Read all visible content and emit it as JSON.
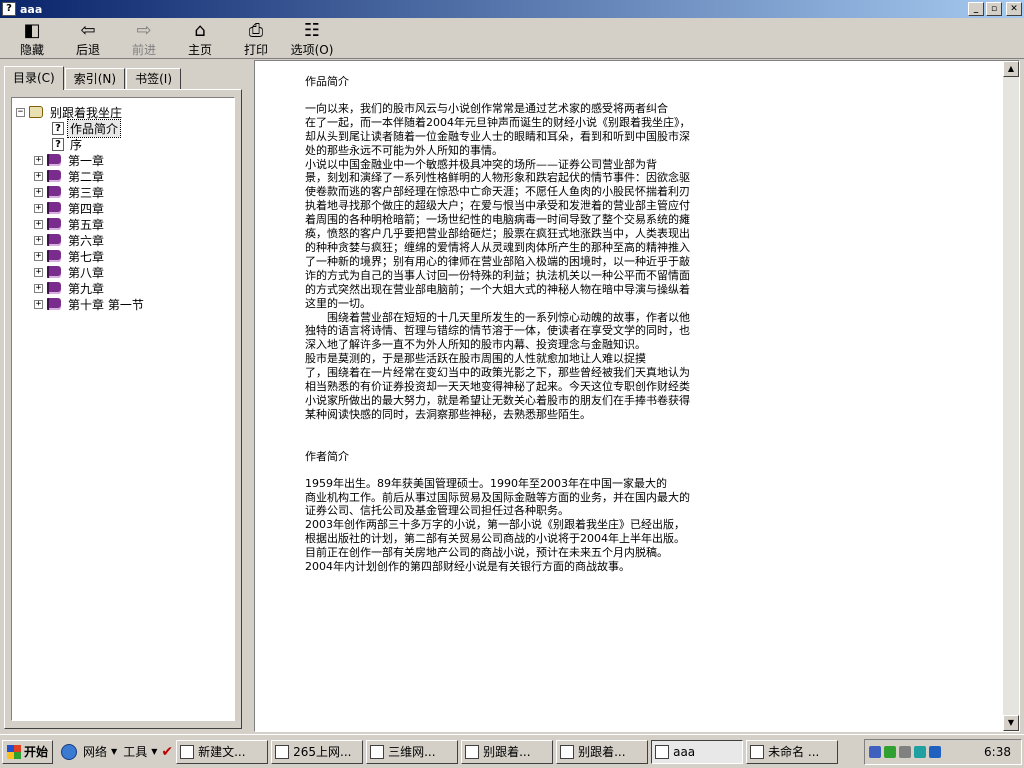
{
  "window": {
    "title": "aaa",
    "icon": "help-file-icon"
  },
  "toolbar": [
    {
      "name": "hide",
      "label": "隐藏",
      "icon": "hide-icon",
      "glyph": "◧",
      "enabled": true
    },
    {
      "name": "back",
      "label": "后退",
      "icon": "back-arrow-icon",
      "glyph": "⇦",
      "enabled": true
    },
    {
      "name": "forward",
      "label": "前进",
      "icon": "forward-arrow-icon",
      "glyph": "⇨",
      "enabled": false
    },
    {
      "name": "home",
      "label": "主页",
      "icon": "home-icon",
      "glyph": "⌂",
      "enabled": true
    },
    {
      "name": "print",
      "label": "打印",
      "icon": "printer-icon",
      "glyph": "⎙",
      "enabled": true
    },
    {
      "name": "options",
      "label": "选项(O)",
      "icon": "options-icon",
      "glyph": "☷",
      "enabled": true
    }
  ],
  "tabs": [
    {
      "label": "目录(C)",
      "active": true
    },
    {
      "label": "索引(N)",
      "active": false
    },
    {
      "label": "书签(I)",
      "active": false
    }
  ],
  "tree": {
    "root": "别跟着我坐庄",
    "pages": [
      {
        "label": "作品简介",
        "selected": true
      },
      {
        "label": "序",
        "selected": false
      }
    ],
    "chapters": [
      "第一章",
      "第二章",
      "第三章",
      "第四章",
      "第五章",
      "第六章",
      "第七章",
      "第八章",
      "第九章",
      "第十章 第一节"
    ]
  },
  "content": {
    "intro_title": "作品简介",
    "intro_lines": [
      "一向以来，我们的股市风云与小说创作常常是通过艺术家的感受将两者纠合",
      "在了一起，而一本伴随着2004年元旦钟声而诞生的财经小说《别跟着我坐庄》，",
      "却从头到尾让读者随着一位金融专业人士的眼睛和耳朵，看到和听到中国股市深",
      "处的那些永远不可能为外人所知的事情。",
      "小说以中国金融业中一个敏感并极具冲突的场所——证券公司营业部为背",
      "景，刻划和演绎了一系列性格鲜明的人物形象和跌宕起伏的情节事件：因欲念驱",
      "使卷款而逃的客户部经理在惊恐中亡命天涯；不愿任人鱼肉的小股民怀揣着利刃",
      "执着地寻找那个做庄的超级大户；在爱与恨当中承受和发泄着的营业部主管应付",
      "着周围的各种明枪暗箭；一场世纪性的电脑病毒一时间导致了整个交易系统的瘫",
      "痪，愤怒的客户几乎要把营业部给砸烂；股票在疯狂式地涨跌当中，人类表现出",
      "的种种贪婪与疯狂；缠绵的爱情将人从灵魂到肉体所产生的那种至高的精神推入",
      "了一种新的境界；别有用心的律师在营业部陷入极端的困境时，以一种近乎于敲",
      "诈的方式为自己的当事人讨回一份特殊的利益；执法机关以一种公平而不留情面",
      "的方式突然出现在营业部电脑前；一个大姐大式的神秘人物在暗中导演与操纵着",
      "这里的一切。",
      "　　围绕着营业部在短短的十几天里所发生的一系列惊心动魄的故事，作者以他",
      "独特的语言将诗情、哲理与错综的情节溶于一体，使读者在享受文学的同时，也",
      "深入地了解许多一直不为外人所知的股市内幕、投资理念与金融知识。",
      "股市是莫测的，于是那些活跃在股市周围的人性就愈加地让人难以捉摸",
      "了，围绕着在一片经常在变幻当中的政策光影之下，那些曾经被我们天真地认为",
      "相当熟悉的有价证券投资却一天天地变得神秘了起来。今天这位专职创作财经类",
      "小说家所做出的最大努力，就是希望让无数关心着股市的朋友们在手捧书卷获得",
      "某种阅读快感的同时，去洞察那些神秘，去熟悉那些陌生。"
    ],
    "author_title": "作者简介",
    "author_lines": [
      "1959年出生。89年获美国管理硕士。1990年至2003年在中国一家最大的",
      "商业机构工作。前后从事过国际贸易及国际金融等方面的业务，并在国内最大的",
      "证券公司、信托公司及基金管理公司担任过各种职务。",
      "2003年创作两部三十多万字的小说，第一部小说《别跟着我坐庄》已经出版，",
      "根据出版社的计划，第二部有关贸易公司商战的小说将于2004年上半年出版。",
      "目前正在创作一部有关房地产公司的商战小说，预计在未来五个月内脱稿。",
      "2004年内计划创作的第四部财经小说是有关银行方面的商战故事。"
    ]
  },
  "taskbar": {
    "start_label": "开始",
    "quicklaunch": [
      "网络",
      "工具"
    ],
    "tasks": [
      {
        "label": "新建文...",
        "icon": "folder-icon",
        "active": false
      },
      {
        "label": "265上网...",
        "icon": "browser-icon",
        "active": false
      },
      {
        "label": "三维网...",
        "icon": "browser-icon",
        "active": false
      },
      {
        "label": "别跟着...",
        "icon": "browser-icon",
        "active": false
      },
      {
        "label": "别跟着...",
        "icon": "book-icon",
        "active": false
      },
      {
        "label": "aaa",
        "icon": "help-file-icon",
        "active": true
      },
      {
        "label": "未命名 ...",
        "icon": "paint-icon",
        "active": false
      }
    ],
    "clock": "6:38"
  }
}
